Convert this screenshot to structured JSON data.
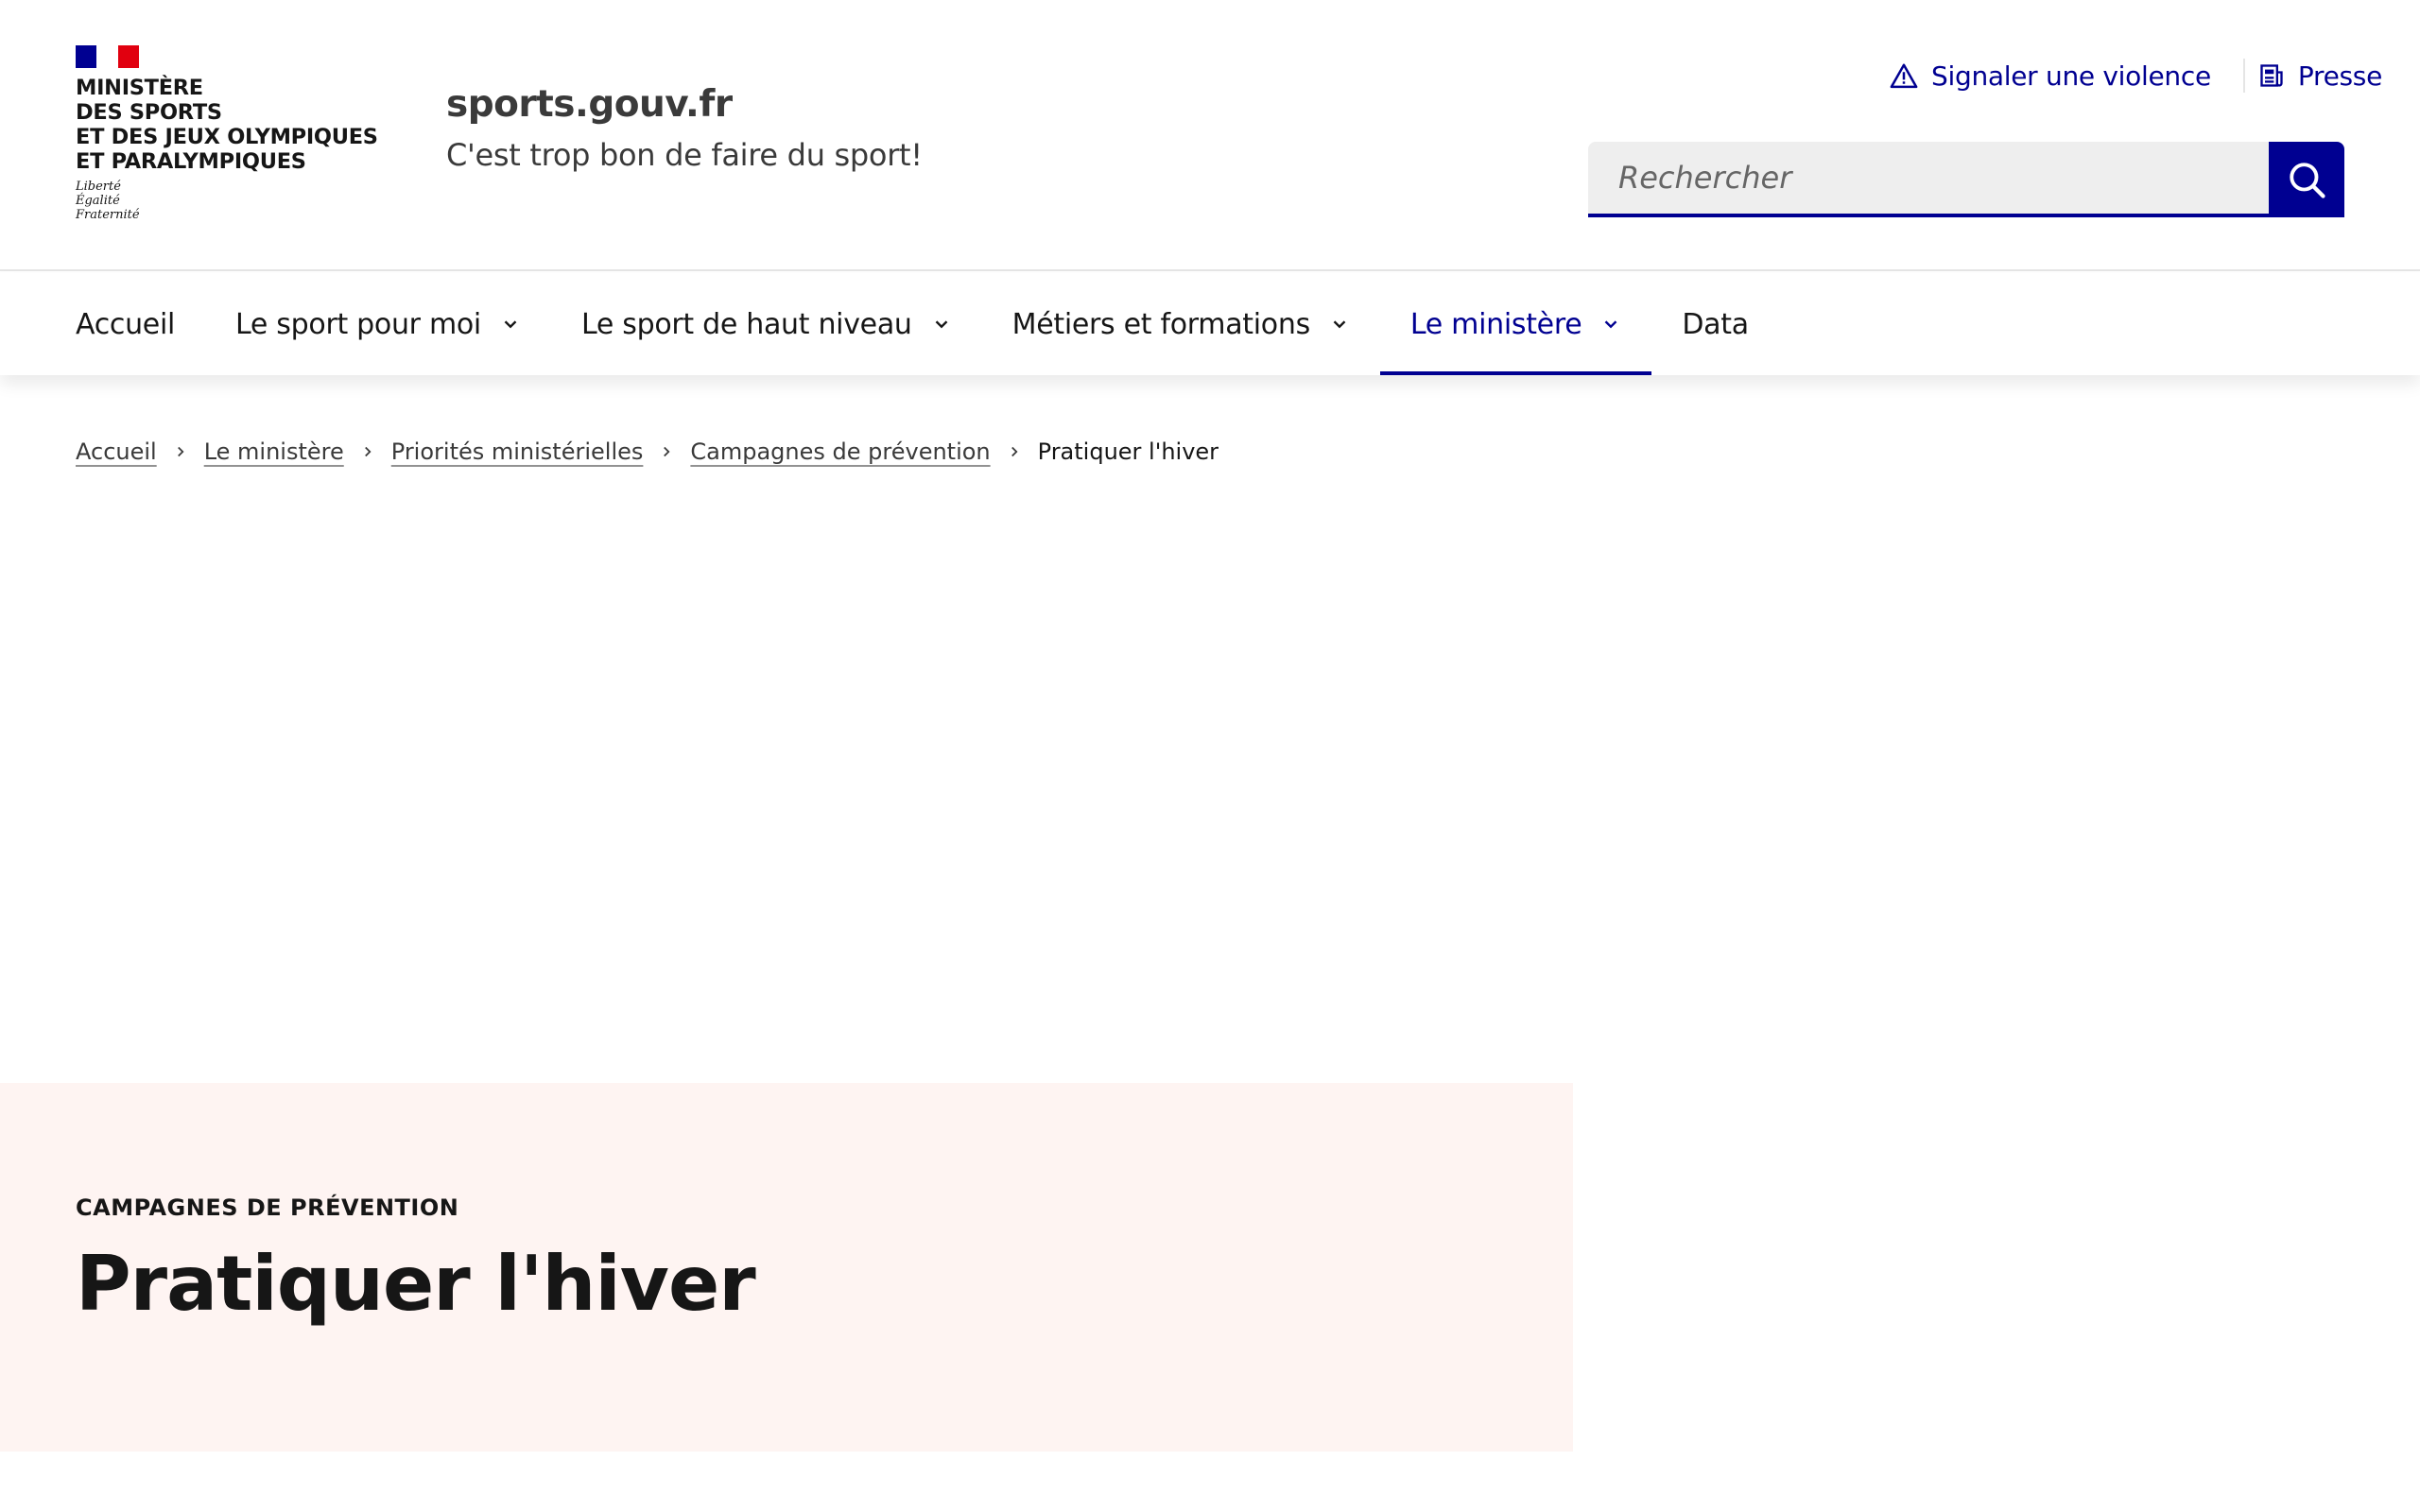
{
  "header": {
    "ministry_name": "MINISTÈRE\nDES SPORTS\nET DES JEUX OLYMPIQUES\nET PARALYMPIQUES",
    "motto": "Liberté\nÉgalité\nFraternité",
    "site_title": "sports.gouv.fr",
    "tagline": "C'est trop bon de faire du sport!",
    "tools": {
      "report_label": "Signaler une violence",
      "press_label": "Presse"
    },
    "search": {
      "placeholder": "Rechercher"
    }
  },
  "nav": {
    "items": [
      {
        "label": "Accueil"
      },
      {
        "label": "Le sport pour moi"
      },
      {
        "label": "Le sport de haut niveau"
      },
      {
        "label": "Métiers et formations"
      },
      {
        "label": "Le ministère"
      },
      {
        "label": "Data"
      }
    ]
  },
  "breadcrumb": {
    "items": [
      {
        "label": "Accueil"
      },
      {
        "label": "Le ministère"
      },
      {
        "label": "Priorités ministérielles"
      },
      {
        "label": "Campagnes de prévention"
      }
    ],
    "current": "Pratiquer l'hiver"
  },
  "hero": {
    "kicker": "CAMPAGNES DE PRÉVENTION",
    "title": "Pratiquer l'hiver"
  },
  "colors": {
    "brand_blue": "#000091",
    "marianne_red": "#e1000f",
    "hero_background": "#fef4f2"
  }
}
